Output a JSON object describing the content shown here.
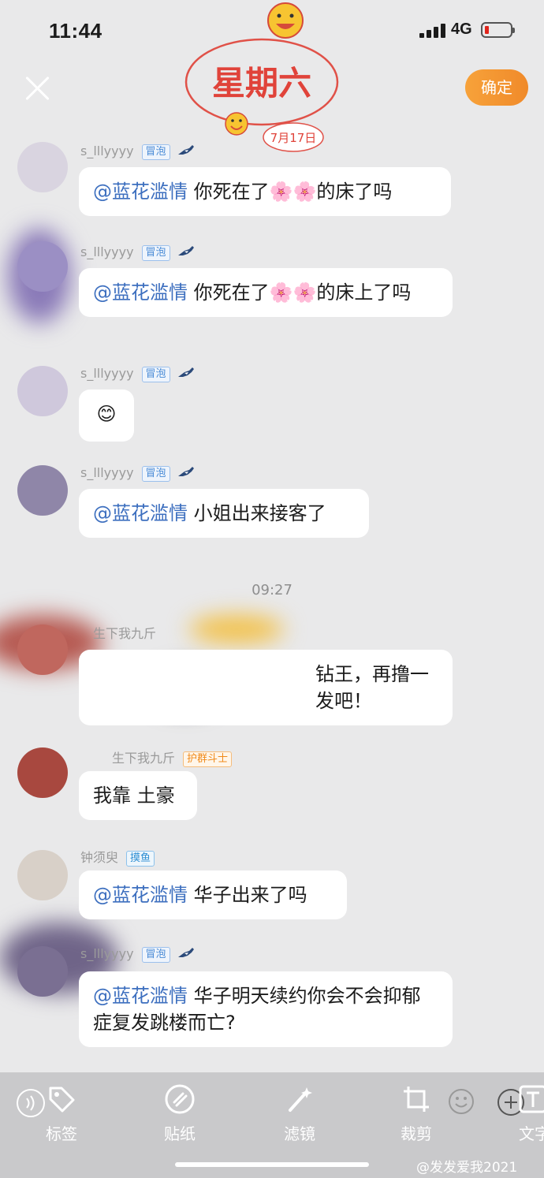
{
  "status_bar": {
    "time": "11:44",
    "network": "4G"
  },
  "header": {
    "confirm_label": "确定"
  },
  "sticker": {
    "weekday": "星期六",
    "date": "7月17日"
  },
  "messages": [
    {
      "sender": "s_lllyyyy",
      "tag": "冒泡",
      "mention": "@蓝花滥情",
      "text": " 你死在了🌸🌸的床了吗"
    },
    {
      "sender": "s_lllyyyy",
      "tag": "冒泡",
      "mention": "@蓝花滥情",
      "text": " 你死在了🌸🌸的床上了吗"
    },
    {
      "sender": "s_lllyyyy",
      "tag": "冒泡",
      "text": "😊"
    },
    {
      "sender": "s_lllyyyy",
      "tag": "冒泡",
      "mention": "@蓝花滥情",
      "text": " 小姐出来接客了"
    },
    {
      "sender": "生下我九斤",
      "tag": "",
      "text": "钻王，再撸一发吧！"
    },
    {
      "sender": "生下我九斤",
      "tag": "护群斗士",
      "text": "我靠 土豪"
    },
    {
      "sender": "钟须臾",
      "tag": "摸鱼",
      "mention": "@蓝花滥情",
      "text": " 华子出来了吗"
    },
    {
      "sender": "s_lllyyyy",
      "tag": "冒泡",
      "mention": "@蓝花滥情",
      "text": " 华子明天续约你会不会抑郁症复发跳楼而亡?"
    }
  ],
  "timestamp": "09:27",
  "toolbar": [
    {
      "label": "标签",
      "icon": "tag-icon"
    },
    {
      "label": "贴纸",
      "icon": "sticker-icon"
    },
    {
      "label": "滤镜",
      "icon": "magic-wand-icon"
    },
    {
      "label": "裁剪",
      "icon": "crop-icon"
    },
    {
      "label": "文字",
      "icon": "text-icon"
    }
  ],
  "watermark": "@发发爱我2021"
}
